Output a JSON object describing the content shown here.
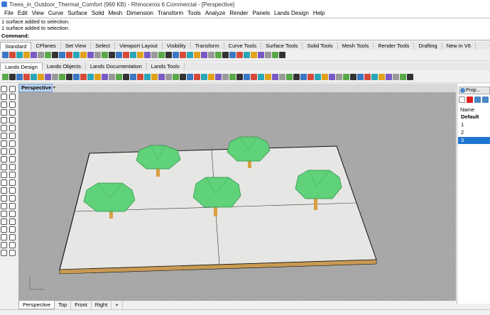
{
  "window": {
    "title": "Trees_in_Outdoor_Thermal_Comfort (969 KB) - Rhinoceros 6 Commercial - [Perspective]"
  },
  "menu": [
    "File",
    "Edit",
    "View",
    "Curve",
    "Surface",
    "Solid",
    "Mesh",
    "Dimension",
    "Transform",
    "Tools",
    "Analyze",
    "Render",
    "Panels",
    "Lands Design",
    "Help"
  ],
  "command_history": [
    "1 surface added to selection.",
    "1 surface added to selection."
  ],
  "command_prompt": "Command:",
  "toolbar_tabs": [
    "Standard",
    "CPlanes",
    "Set View",
    "Select",
    "Viewport Layout",
    "Visibility",
    "Transform",
    "Curve Tools",
    "Surface Tools",
    "Solid Tools",
    "Mesh Tools",
    "Render Tools",
    "Drafting",
    "New in V6"
  ],
  "lands_tabs": [
    "Lands Design",
    "Lands Objects",
    "Lands Documentation",
    "Lands Tools"
  ],
  "viewport": {
    "name": "Perspective",
    "dropdown": "▾"
  },
  "bottom_tabs": [
    "Perspective",
    "Top",
    "Front",
    "Right",
    "+"
  ],
  "panel": {
    "tab_label": "Prop...",
    "header": "Name",
    "rows": [
      "Default",
      "1",
      "2",
      "3"
    ],
    "selected_row": "3"
  },
  "colors": {
    "tree_green": "#5fd27a",
    "trunk": "#d8a040",
    "base": "#e6e6e4",
    "grid_bg": "#a8a8a8",
    "selection": "#1f76d2"
  }
}
